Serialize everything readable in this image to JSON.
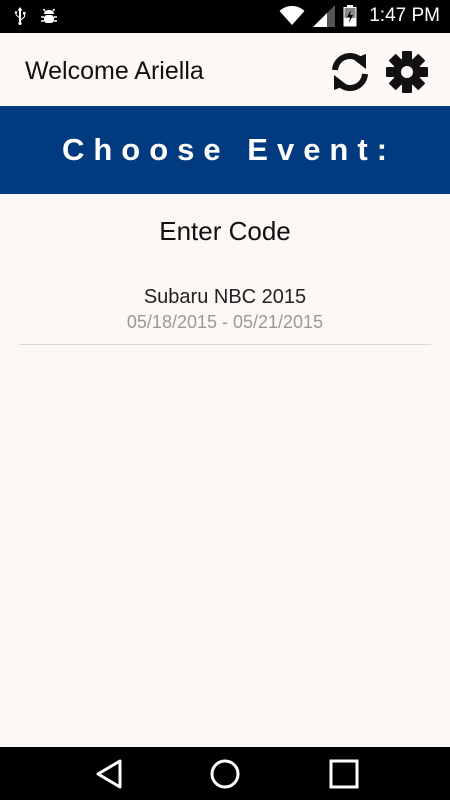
{
  "status_bar": {
    "time": "1:47 PM",
    "icons": [
      "usb-icon",
      "debug-bug-icon",
      "wifi-icon",
      "cellular-signal-icon",
      "battery-charging-icon"
    ]
  },
  "header": {
    "welcome_text": "Welcome Ariella",
    "refresh_icon": "refresh-icon",
    "settings_icon": "gear-icon"
  },
  "banner": {
    "title": "Choose Event:",
    "color": "#023a7f"
  },
  "main": {
    "enter_code_label": "Enter Code",
    "events": [
      {
        "name": "Subaru NBC 2015",
        "dates": "05/18/2015 - 05/21/2015"
      }
    ]
  },
  "nav_bar": {
    "icons": [
      "back-icon",
      "home-icon",
      "recents-icon"
    ]
  },
  "colors": {
    "background": "#fdf8f5",
    "banner": "#023a7f",
    "status_bar": "#000000"
  }
}
